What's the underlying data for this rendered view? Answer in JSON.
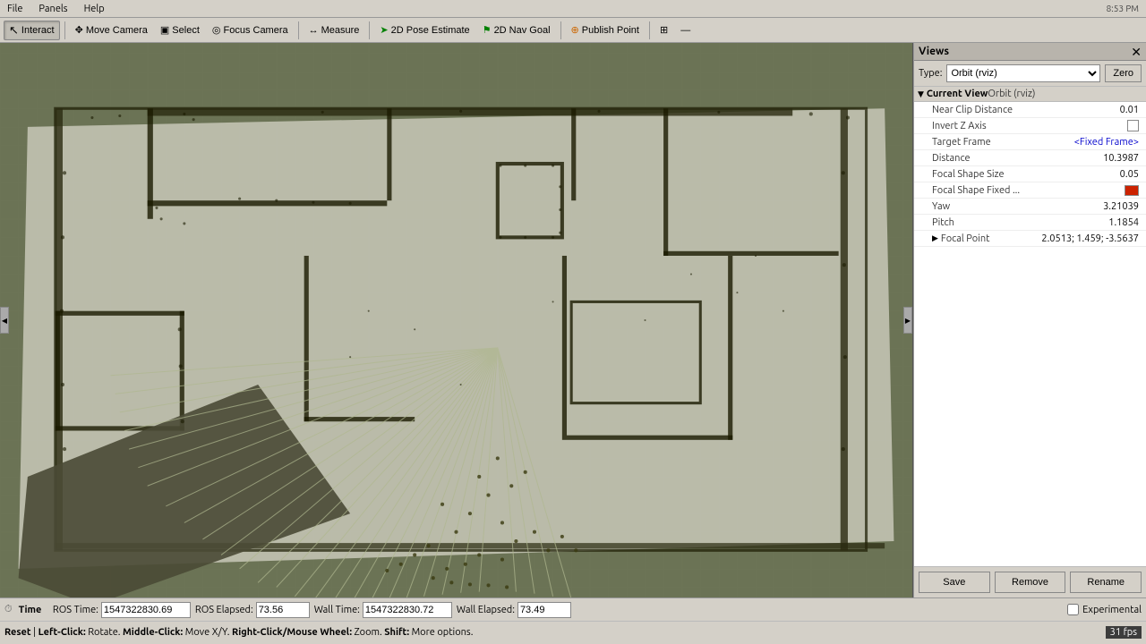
{
  "menubar": {
    "items": [
      "File",
      "Panels",
      "Help"
    ]
  },
  "toolbar": {
    "buttons": [
      {
        "id": "interact",
        "label": "Interact",
        "icon": "↖",
        "active": true
      },
      {
        "id": "move-camera",
        "label": "Move Camera",
        "icon": "✥",
        "active": false
      },
      {
        "id": "select",
        "label": "Select",
        "icon": "◫",
        "active": false
      },
      {
        "id": "focus-camera",
        "label": "Focus Camera",
        "icon": "◎",
        "active": false
      },
      {
        "id": "measure",
        "label": "Measure",
        "icon": "↔",
        "active": false
      },
      {
        "id": "2d-pose",
        "label": "2D Pose Estimate",
        "icon": "➤",
        "active": false
      },
      {
        "id": "2d-nav",
        "label": "2D Nav Goal",
        "icon": "⚑",
        "active": false
      },
      {
        "id": "publish",
        "label": "Publish Point",
        "icon": "⊕",
        "active": false
      }
    ]
  },
  "panel": {
    "title": "Views",
    "type_label": "Type:",
    "type_value": "Orbit (rviz)",
    "zero_label": "Zero",
    "current_view_label": "Current View",
    "current_view_type": "Orbit (rviz)",
    "properties": {
      "near_clip_distance": {
        "label": "Near Clip Distance",
        "value": "0.01"
      },
      "invert_z_axis": {
        "label": "Invert Z Axis",
        "value": "",
        "type": "checkbox",
        "checked": false
      },
      "target_frame": {
        "label": "Target Frame",
        "value": "<Fixed Frame>"
      },
      "distance": {
        "label": "Distance",
        "value": "10.3987"
      },
      "focal_shape_size": {
        "label": "Focal Shape Size",
        "value": "0.05"
      },
      "focal_shape_fixed": {
        "label": "Focal Shape Fixed ...",
        "value": "",
        "type": "color",
        "color": "#cc2200"
      },
      "yaw": {
        "label": "Yaw",
        "value": "3.21039"
      },
      "pitch": {
        "label": "Pitch",
        "value": "1.1854"
      },
      "focal_point": {
        "label": "Focal Point",
        "value": "2.0513; 1.459; -3.5637",
        "expandable": true
      }
    },
    "buttons": {
      "save": "Save",
      "remove": "Remove",
      "rename": "Rename"
    }
  },
  "statusbar": {
    "time_label": "Time",
    "ros_time_label": "ROS Time:",
    "ros_time_value": "1547322830.69",
    "ros_elapsed_label": "ROS Elapsed:",
    "ros_elapsed_value": "73.56",
    "wall_time_label": "Wall Time:",
    "wall_time_value": "1547322830.72",
    "wall_elapsed_label": "Wall Elapsed:",
    "wall_elapsed_value": "73.49",
    "hint": "Reset | Left-Click: Rotate. Middle-Click: Move X/Y. Right-Click/Mouse Wheel: Zoom. Shift: More options.",
    "experimental_label": "Experimental",
    "fps": "31 fps"
  },
  "system": {
    "time": "8:53 PM"
  }
}
